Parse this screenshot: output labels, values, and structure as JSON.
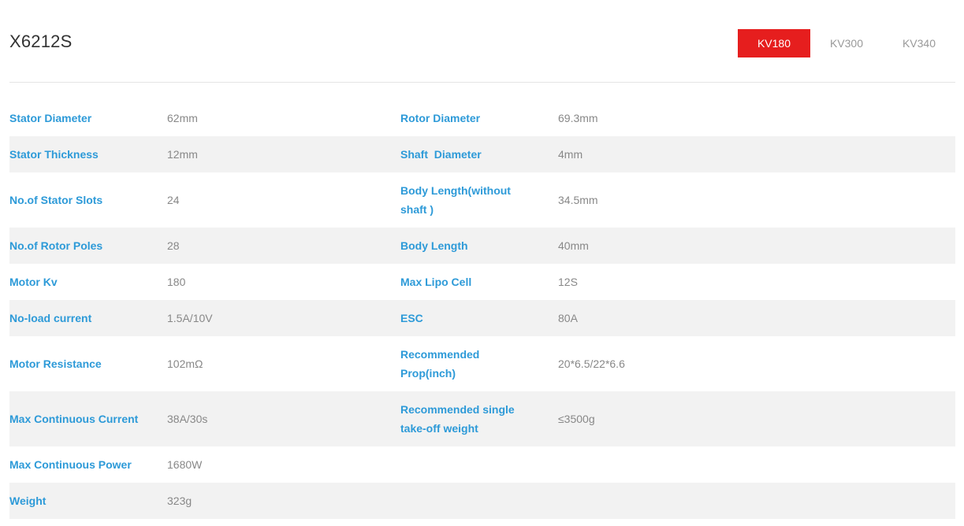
{
  "product": {
    "title": "X6212S"
  },
  "tabs": [
    {
      "label": "KV180",
      "active": true
    },
    {
      "label": "KV300",
      "active": false
    },
    {
      "label": "KV340",
      "active": false
    }
  ],
  "colors": {
    "accent": "#e61e1e",
    "key_text": "#2d9ad8",
    "value_text": "#888888",
    "alt_row": "#f2f2f2"
  },
  "specs": [
    {
      "k1": "Stator Diameter",
      "v1": "62mm",
      "k2": "Rotor Diameter",
      "v2": "69.3mm"
    },
    {
      "k1": "Stator Thickness",
      "v1": "12mm",
      "k2": "Shaft  Diameter",
      "v2": "4mm"
    },
    {
      "k1": "No.of Stator Slots",
      "v1": "24",
      "k2": "Body Length(without shaft )",
      "v2": "34.5mm"
    },
    {
      "k1": "No.of Rotor Poles",
      "v1": "28",
      "k2": "Body Length",
      "v2": "40mm"
    },
    {
      "k1": "Motor Kv",
      "v1": "180",
      "k2": "Max Lipo Cell",
      "v2": "12S"
    },
    {
      "k1": "No-load current",
      "v1": "1.5A/10V",
      "k2": "ESC",
      "v2": "80A"
    },
    {
      "k1": "Motor Resistance",
      "v1": "102mΩ",
      "k2": "Recommended Prop(inch)",
      "v2": "20*6.5/22*6.6"
    },
    {
      "k1": "Max Continuous Current",
      "v1": "38A/30s",
      "k2": "Recommended single take-off weight",
      "v2": "≤3500g"
    },
    {
      "k1": "Max Continuous Power",
      "v1": "1680W",
      "k2": "",
      "v2": ""
    },
    {
      "k1": "Weight",
      "v1": "323g",
      "k2": "",
      "v2": ""
    }
  ]
}
